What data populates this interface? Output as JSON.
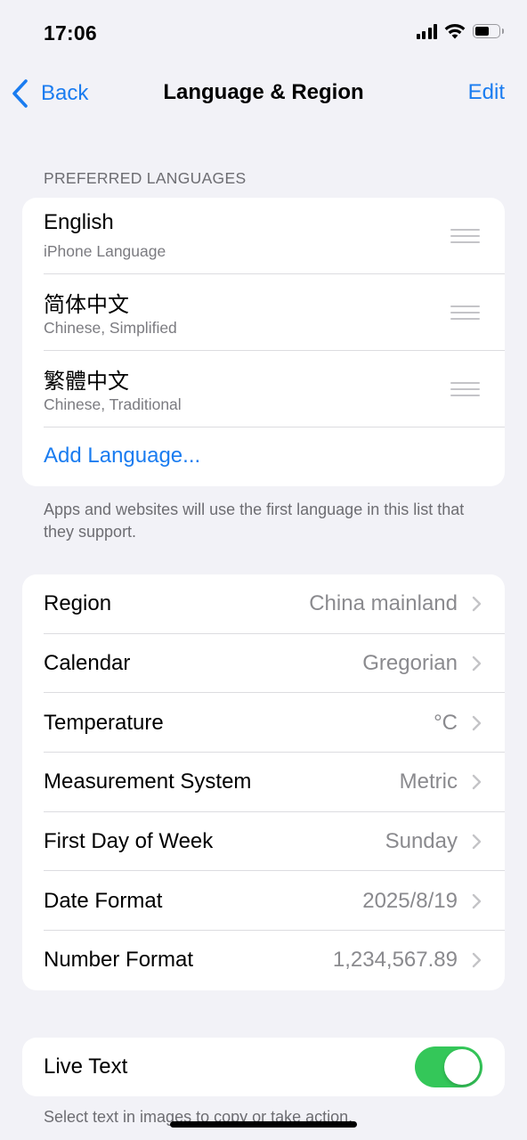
{
  "status_bar": {
    "time": "17:06",
    "icons": [
      "cellular-signal-icon",
      "wifi-icon",
      "battery-icon"
    ],
    "battery_level": 0.6
  },
  "nav": {
    "back_label": "Back",
    "back_icon": "chevron-left-icon",
    "title": "Language & Region",
    "edit_label": "Edit"
  },
  "preferred_languages": {
    "header": "PREFERRED LANGUAGES",
    "items": [
      {
        "name": "English",
        "subtitle": "iPhone Language"
      },
      {
        "name": "简体中文",
        "subtitle": "Chinese, Simplified"
      },
      {
        "name": "繁體中文",
        "subtitle": "Chinese, Traditional"
      }
    ],
    "add_label": "Add Language...",
    "footer": "Apps and websites will use the first language in this list that they support."
  },
  "region_settings": {
    "items": [
      {
        "label": "Region",
        "value": "China mainland"
      },
      {
        "label": "Calendar",
        "value": "Gregorian"
      },
      {
        "label": "Temperature",
        "value": "°C"
      },
      {
        "label": "Measurement System",
        "value": "Metric"
      },
      {
        "label": "First Day of Week",
        "value": "Sunday"
      },
      {
        "label": "Date Format",
        "value": "2025/8/19"
      },
      {
        "label": "Number Format",
        "value": "1,234,567.89"
      }
    ]
  },
  "live_text": {
    "label": "Live Text",
    "enabled": true,
    "footer": "Select text in images to copy or take action."
  },
  "colors": {
    "accent": "#1a7cf0",
    "toggle_on": "#34c759",
    "background": "#f2f2f7"
  }
}
